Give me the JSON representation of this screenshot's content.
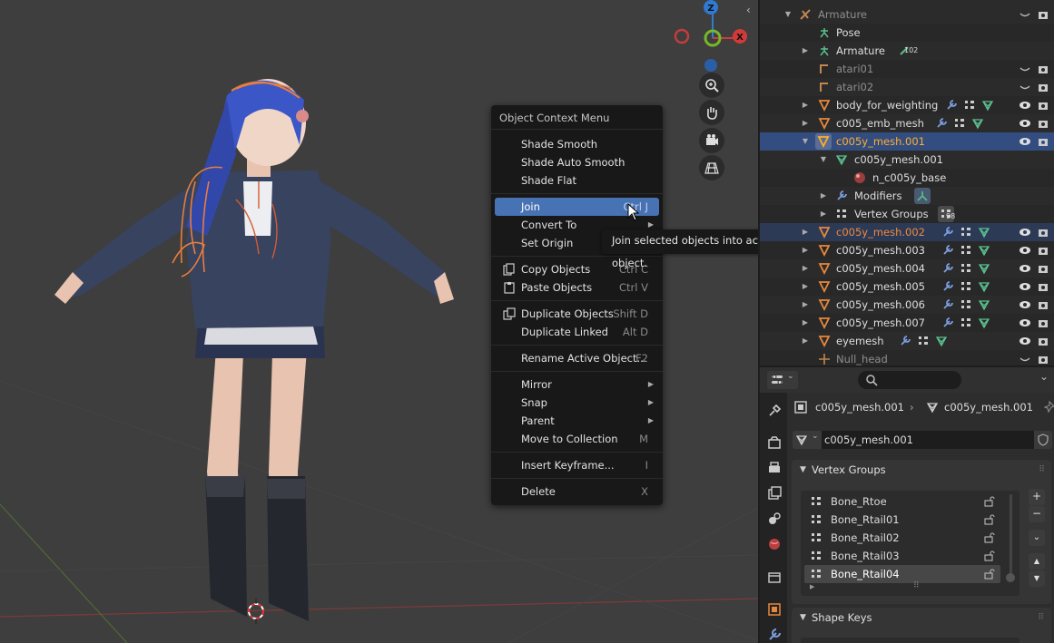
{
  "viewport": {
    "gizmo": {
      "z_label": "Z",
      "x_label": "X"
    }
  },
  "context_menu": {
    "title": "Object Context Menu",
    "items": [
      {
        "label": "Shade Smooth",
        "shortcut": "",
        "submenu": false
      },
      {
        "label": "Shade Auto Smooth",
        "shortcut": "",
        "submenu": false
      },
      {
        "label": "Shade Flat",
        "shortcut": "",
        "submenu": false
      },
      {
        "label": "Join",
        "shortcut": "Ctrl J",
        "submenu": false,
        "highlighted": true
      },
      {
        "label": "Convert To",
        "shortcut": "",
        "submenu": true
      },
      {
        "label": "Set Origin",
        "shortcut": "",
        "submenu": true
      },
      {
        "label": "Copy Objects",
        "shortcut": "Ctrl C",
        "icon": "copy-icon"
      },
      {
        "label": "Paste Objects",
        "shortcut": "Ctrl V",
        "icon": "paste-icon"
      },
      {
        "label": "Duplicate Objects",
        "shortcut": "Shift D",
        "icon": "duplicate-icon"
      },
      {
        "label": "Duplicate Linked",
        "shortcut": "Alt D"
      },
      {
        "label": "Rename Active Object...",
        "shortcut": "F2"
      },
      {
        "label": "Mirror",
        "shortcut": "",
        "submenu": true
      },
      {
        "label": "Snap",
        "shortcut": "",
        "submenu": true
      },
      {
        "label": "Parent",
        "shortcut": "",
        "submenu": true
      },
      {
        "label": "Move to Collection",
        "shortcut": "M"
      },
      {
        "label": "Insert Keyframe...",
        "shortcut": "I"
      },
      {
        "label": "Delete",
        "shortcut": "X"
      }
    ],
    "tooltip": "Join selected objects into active object."
  },
  "outliner": {
    "rows": [
      {
        "name": "Armature",
        "dim": true,
        "icon": "armature-icon"
      },
      {
        "name": "Pose",
        "icon": "pose-icon"
      },
      {
        "name": "Armature",
        "icon": "armature-data-icon",
        "badge": "102"
      },
      {
        "name": "atari01",
        "dim": true,
        "icon": "bone-icon"
      },
      {
        "name": "atari02",
        "dim": true,
        "icon": "bone-icon"
      },
      {
        "name": "body_for_weighting",
        "icon": "mesh-icon"
      },
      {
        "name": "c005_emb_mesh",
        "icon": "mesh-icon"
      },
      {
        "name": "c005y_mesh.001",
        "icon": "mesh-icon",
        "active": true
      },
      {
        "name": "c005y_mesh.001",
        "icon": "mesh-data-icon"
      },
      {
        "name": "n_c005y_base",
        "icon": "material-icon"
      },
      {
        "name": "Modifiers",
        "icon": "wrench-icon"
      },
      {
        "name": "Vertex Groups",
        "icon": "vertex-groups-icon",
        "badge": "98"
      },
      {
        "name": "c005y_mesh.002",
        "icon": "mesh-icon",
        "selected": true
      },
      {
        "name": "c005y_mesh.003",
        "icon": "mesh-icon"
      },
      {
        "name": "c005y_mesh.004",
        "icon": "mesh-icon"
      },
      {
        "name": "c005y_mesh.005",
        "icon": "mesh-icon"
      },
      {
        "name": "c005y_mesh.006",
        "icon": "mesh-icon"
      },
      {
        "name": "c005y_mesh.007",
        "icon": "mesh-icon"
      },
      {
        "name": "eyemesh",
        "icon": "mesh-icon"
      },
      {
        "name": "Null_head",
        "dim": true,
        "icon": "empty-icon"
      }
    ]
  },
  "properties": {
    "breadcrumb": {
      "object": "c005y_mesh.001",
      "data": "c005y_mesh.001"
    },
    "data_name": "c005y_mesh.001",
    "vertex_groups_title": "Vertex Groups",
    "vertex_groups": [
      "Bone_Rtoe",
      "Bone_Rtail01",
      "Bone_Rtail02",
      "Bone_Rtail03",
      "Bone_Rtail04"
    ],
    "shape_keys_title": "Shape Keys"
  },
  "colors": {
    "accent_blue": "#4772b3",
    "active_orange": "#ffaf29",
    "mesh_orange": "#e87d3e",
    "gizmo_z": "#2f7ad2",
    "gizmo_x": "#d23a3a",
    "gizmo_y": "#76b82a"
  }
}
